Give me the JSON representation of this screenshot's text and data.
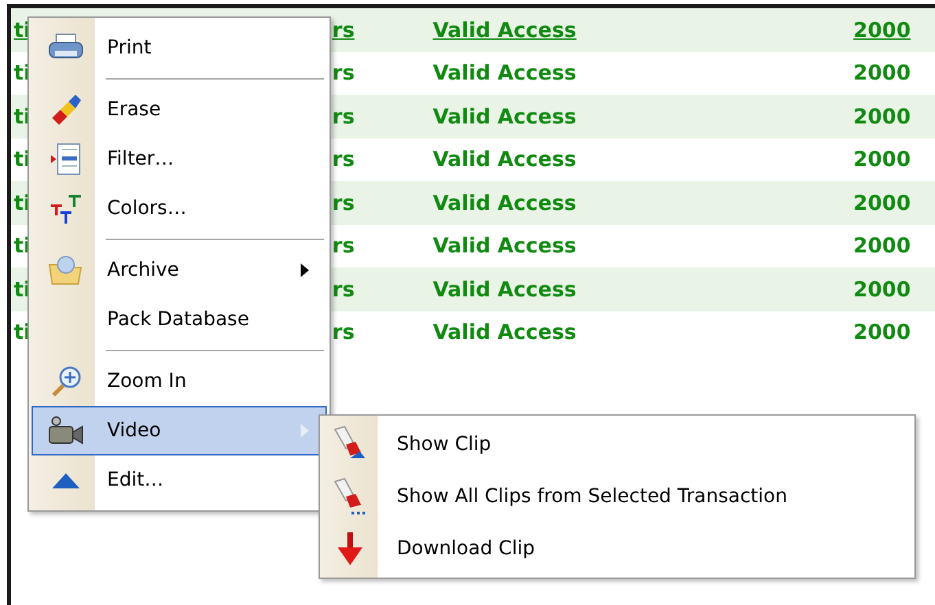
{
  "table": {
    "rows": [
      {
        "cells": [
          "ti",
          "rs",
          "Valid Access",
          "2000"
        ],
        "underlined": true
      },
      {
        "cells": [
          "ti",
          "rs",
          "Valid Access",
          "2000"
        ],
        "underlined": false
      },
      {
        "cells": [
          "ti",
          "rs",
          "Valid Access",
          "2000"
        ],
        "underlined": false
      },
      {
        "cells": [
          "ti",
          "rs",
          "Valid Access",
          "2000"
        ],
        "underlined": false
      },
      {
        "cells": [
          "ti",
          "rs",
          "Valid Access",
          "2000"
        ],
        "underlined": false
      },
      {
        "cells": [
          "ti",
          "rs",
          "Valid Access",
          "2000"
        ],
        "underlined": false
      },
      {
        "cells": [
          "ti",
          "rs",
          "Valid Access",
          "2000"
        ],
        "underlined": false
      },
      {
        "cells": [
          "ti",
          "rs",
          "Valid Access",
          "2000"
        ],
        "underlined": false
      }
    ]
  },
  "context_menu": {
    "items": [
      {
        "kind": "item",
        "label": "Print",
        "submenu": false,
        "selected": false
      },
      {
        "kind": "separator"
      },
      {
        "kind": "item",
        "label": "Erase",
        "submenu": false,
        "selected": false
      },
      {
        "kind": "item",
        "label": "Filter…",
        "submenu": false,
        "selected": false
      },
      {
        "kind": "item",
        "label": "Colors…",
        "submenu": false,
        "selected": false
      },
      {
        "kind": "separator"
      },
      {
        "kind": "item",
        "label": "Archive",
        "submenu": true,
        "selected": false
      },
      {
        "kind": "item",
        "label": "Pack Database",
        "submenu": false,
        "selected": false
      },
      {
        "kind": "separator"
      },
      {
        "kind": "item",
        "label": "Zoom In",
        "submenu": false,
        "selected": false
      },
      {
        "kind": "item",
        "label": "Video",
        "submenu": true,
        "selected": true
      },
      {
        "kind": "item",
        "label": "Edit…",
        "submenu": false,
        "selected": false
      }
    ]
  },
  "submenu": {
    "items": [
      {
        "label": "Show Clip"
      },
      {
        "label": "Show All Clips from Selected Transaction"
      },
      {
        "label": "Download Clip"
      }
    ]
  }
}
